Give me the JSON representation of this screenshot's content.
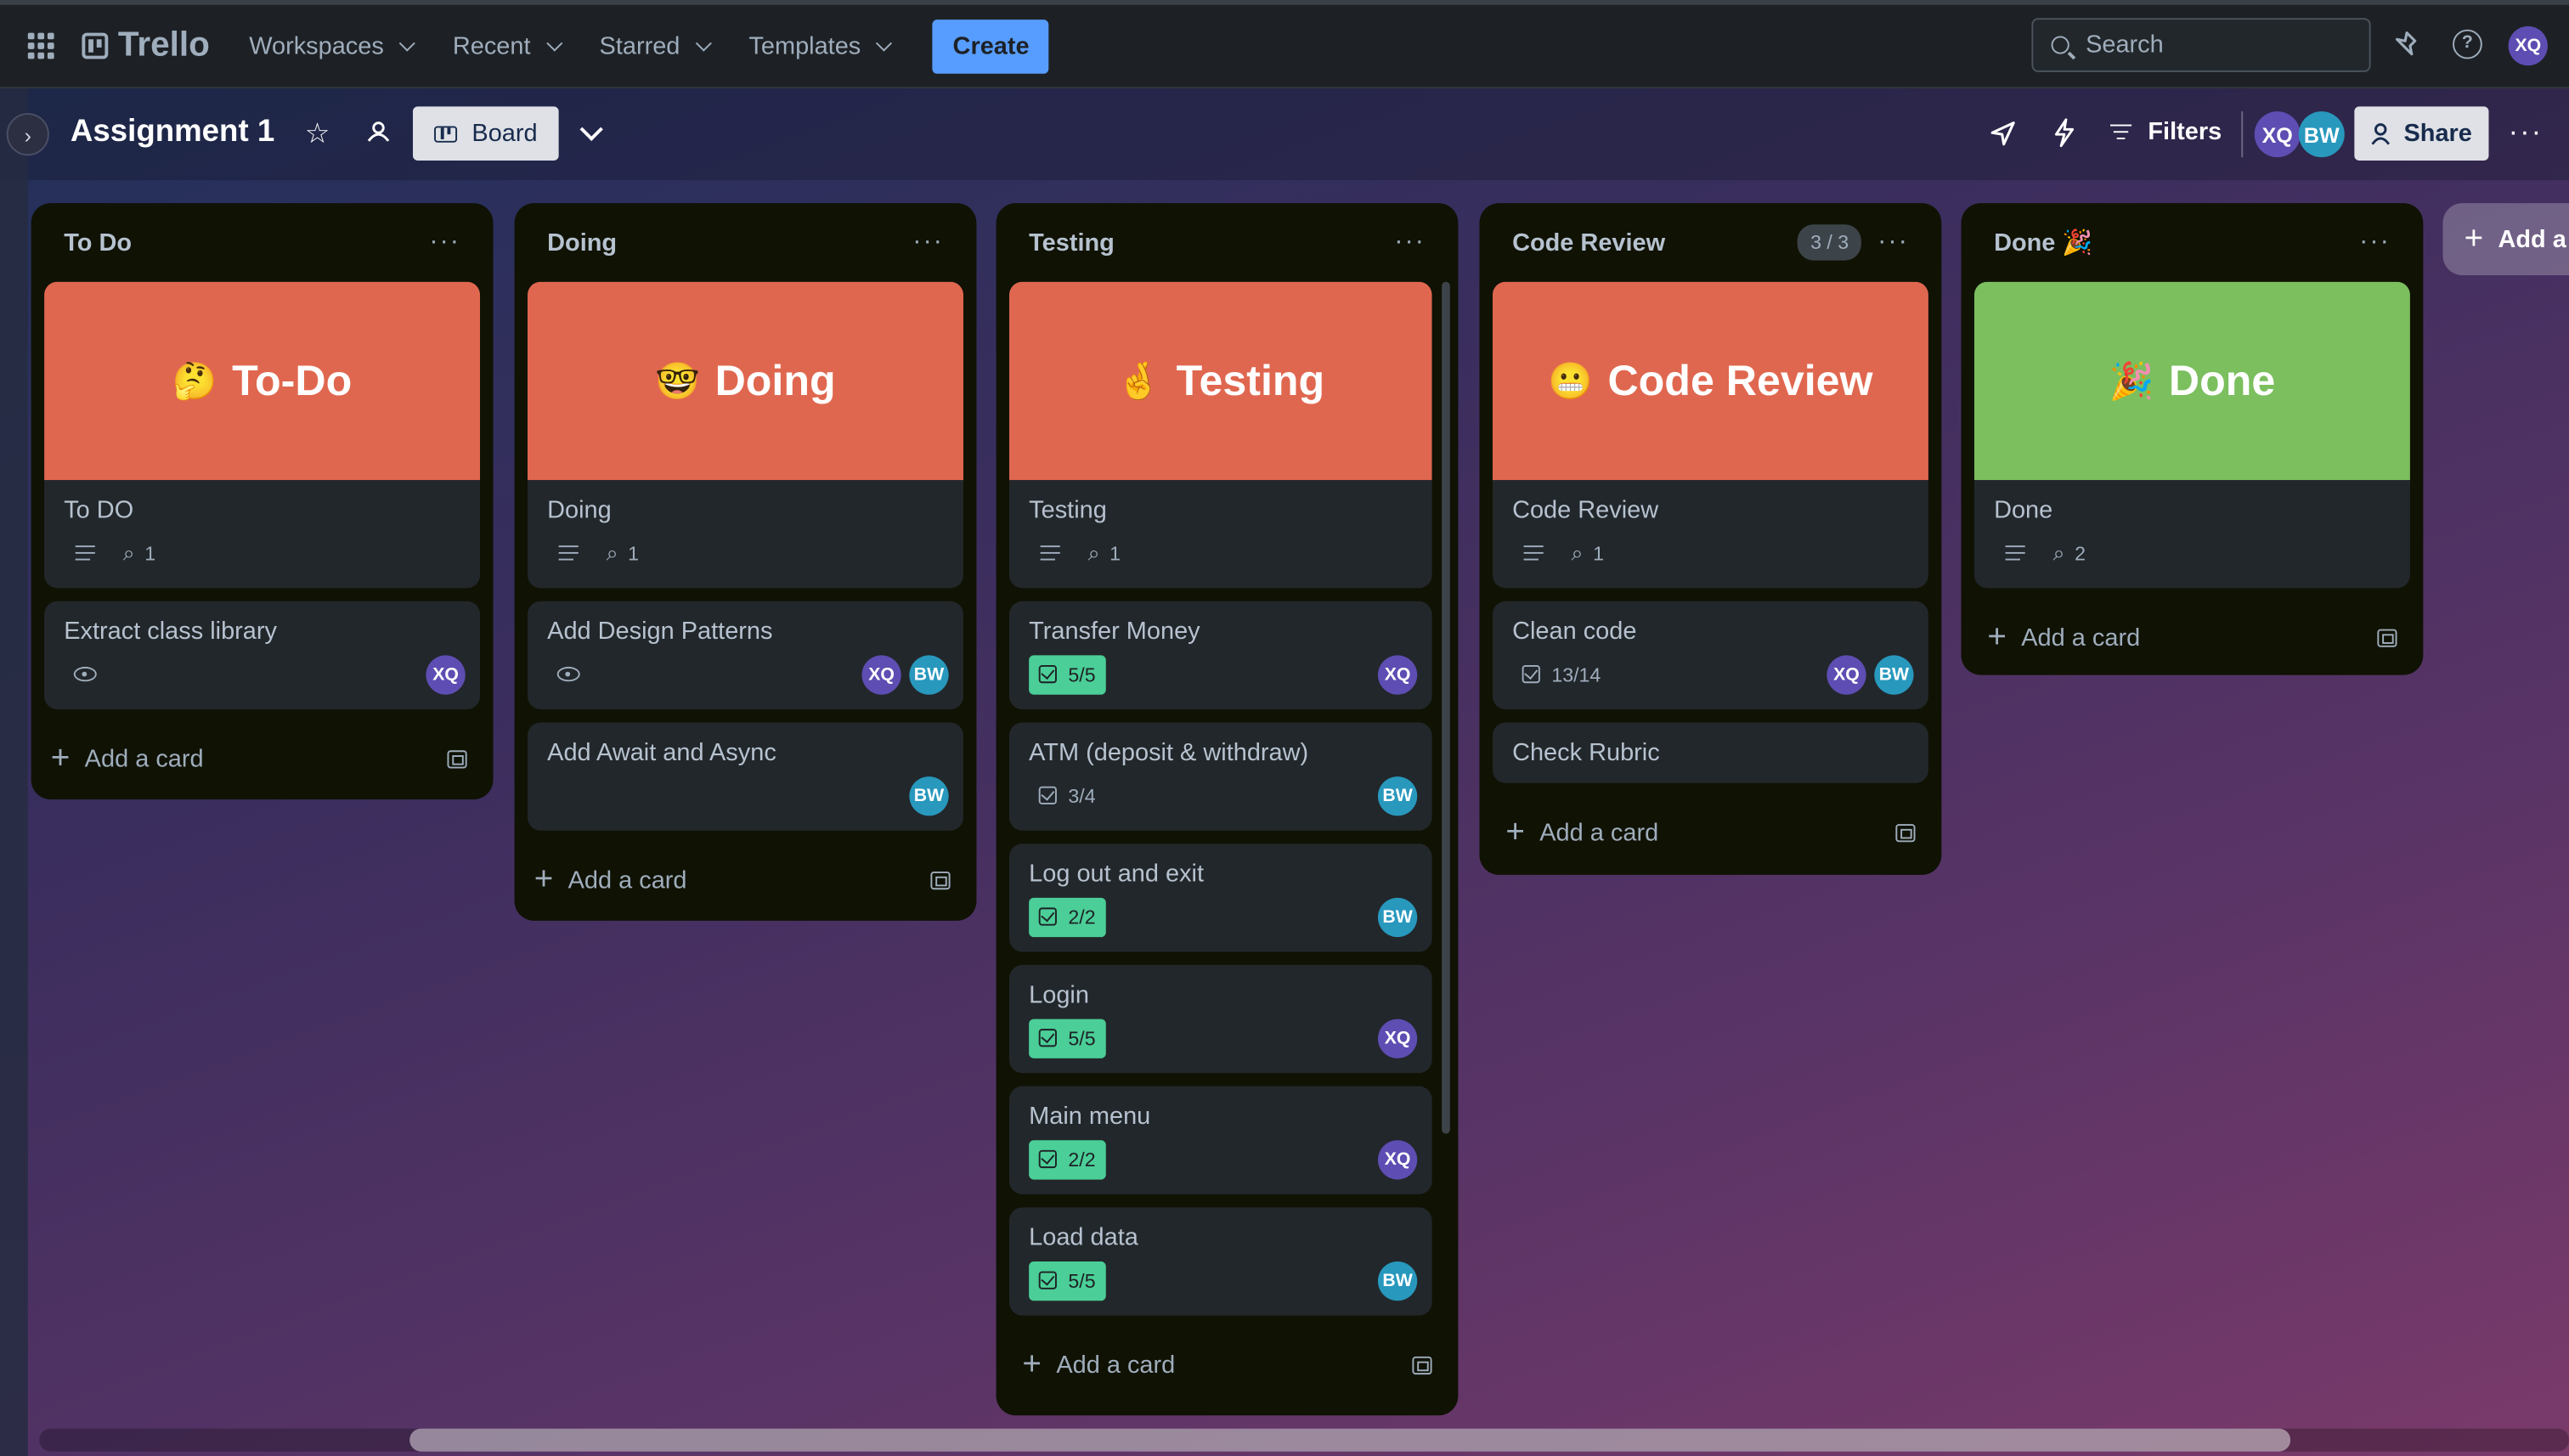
{
  "nav": {
    "logo": "Trello",
    "items": [
      {
        "label": "Workspaces"
      },
      {
        "label": "Recent"
      },
      {
        "label": "Starred"
      },
      {
        "label": "Templates"
      }
    ],
    "create_label": "Create",
    "search_placeholder": "Search",
    "user_initials": "XQ"
  },
  "board": {
    "title": "Assignment 1",
    "view_label": "Board",
    "filters_label": "Filters",
    "share_label": "Share",
    "members": [
      "XQ",
      "BW"
    ]
  },
  "lists": [
    {
      "title": "To Do",
      "cards": [
        {
          "cover": {
            "emoji": "🤔",
            "text": "To-Do",
            "color": "#e0674f"
          },
          "title": "To DO",
          "attachments": "1"
        },
        {
          "title": "Extract class library",
          "watch": true,
          "members": [
            "XQ"
          ]
        }
      ],
      "add_card": "Add a card"
    },
    {
      "title": "Doing",
      "cards": [
        {
          "cover": {
            "emoji": "🤓",
            "text": "Doing",
            "color": "#e0674f"
          },
          "title": "Doing",
          "attachments": "1"
        },
        {
          "title": "Add Design Patterns",
          "watch": true,
          "members": [
            "XQ",
            "BW"
          ]
        },
        {
          "title": "Add Await and Async",
          "members": [
            "BW"
          ]
        }
      ],
      "add_card": "Add a card"
    },
    {
      "title": "Testing",
      "cards": [
        {
          "cover": {
            "emoji": "🤞",
            "text": "Testing",
            "color": "#e0674f"
          },
          "title": "Testing",
          "attachments": "1"
        },
        {
          "title": "Transfer Money",
          "checklist": "5/5",
          "complete": true,
          "members": [
            "XQ"
          ]
        },
        {
          "title": "ATM (deposit & withdraw)",
          "checklist": "3/4",
          "complete": false,
          "members": [
            "BW"
          ]
        },
        {
          "title": "Log out and exit",
          "checklist": "2/2",
          "complete": true,
          "members": [
            "BW"
          ]
        },
        {
          "title": "Login",
          "checklist": "5/5",
          "complete": true,
          "members": [
            "XQ"
          ]
        },
        {
          "title": "Main menu",
          "checklist": "2/2",
          "complete": true,
          "members": [
            "XQ"
          ]
        },
        {
          "title": "Load data",
          "checklist": "5/5",
          "complete": true,
          "members": [
            "BW"
          ]
        }
      ],
      "add_card": "Add a card"
    },
    {
      "title": "Code Review",
      "wip": "3 / 3",
      "cards": [
        {
          "cover": {
            "emoji": "😬",
            "text": "Code Review",
            "color": "#e0674f"
          },
          "title": "Code Review",
          "attachments": "1"
        },
        {
          "title": "Clean code",
          "checklist": "13/14",
          "complete": false,
          "members": [
            "XQ",
            "BW"
          ]
        },
        {
          "title": "Check Rubric"
        }
      ],
      "add_card": "Add a card"
    },
    {
      "title": "Done 🎉",
      "cards": [
        {
          "cover": {
            "emoji": "🎉",
            "text": "Done",
            "color": "#7bbf5e"
          },
          "title": "Done",
          "attachments": "2"
        }
      ],
      "add_card": "Add a card"
    }
  ],
  "add_list_label": "Add a"
}
